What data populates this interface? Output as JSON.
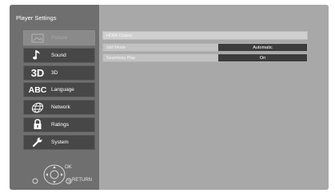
{
  "panel": {
    "title": "Player Settings"
  },
  "menu": [
    {
      "label": "Picture",
      "icon": "picture-icon",
      "state": "disabled"
    },
    {
      "label": "Sound",
      "icon": "music-note-icon",
      "state": "normal"
    },
    {
      "label": "3D",
      "icon": "3d-icon",
      "icon_text": "3D",
      "state": "normal"
    },
    {
      "label": "Language",
      "icon": "abc-icon",
      "icon_text": "ABC",
      "state": "normal"
    },
    {
      "label": "Network",
      "icon": "globe-icon",
      "state": "normal"
    },
    {
      "label": "Ratings",
      "icon": "lock-icon",
      "state": "normal"
    },
    {
      "label": "System",
      "icon": "wrench-icon",
      "state": "normal"
    }
  ],
  "hints": {
    "ok": "OK",
    "return": "RETURN"
  },
  "settings": {
    "section": "HDMI Output",
    "rows": [
      {
        "label": "Still Mode",
        "value": "Automatic"
      },
      {
        "label": "Seamless Play",
        "value": "On"
      }
    ]
  },
  "colors": {
    "left_panel": "#6f6f6f",
    "right_panel": "#a8a8a8",
    "menu_item": "#474747",
    "value_box": "#3c3c3c"
  }
}
